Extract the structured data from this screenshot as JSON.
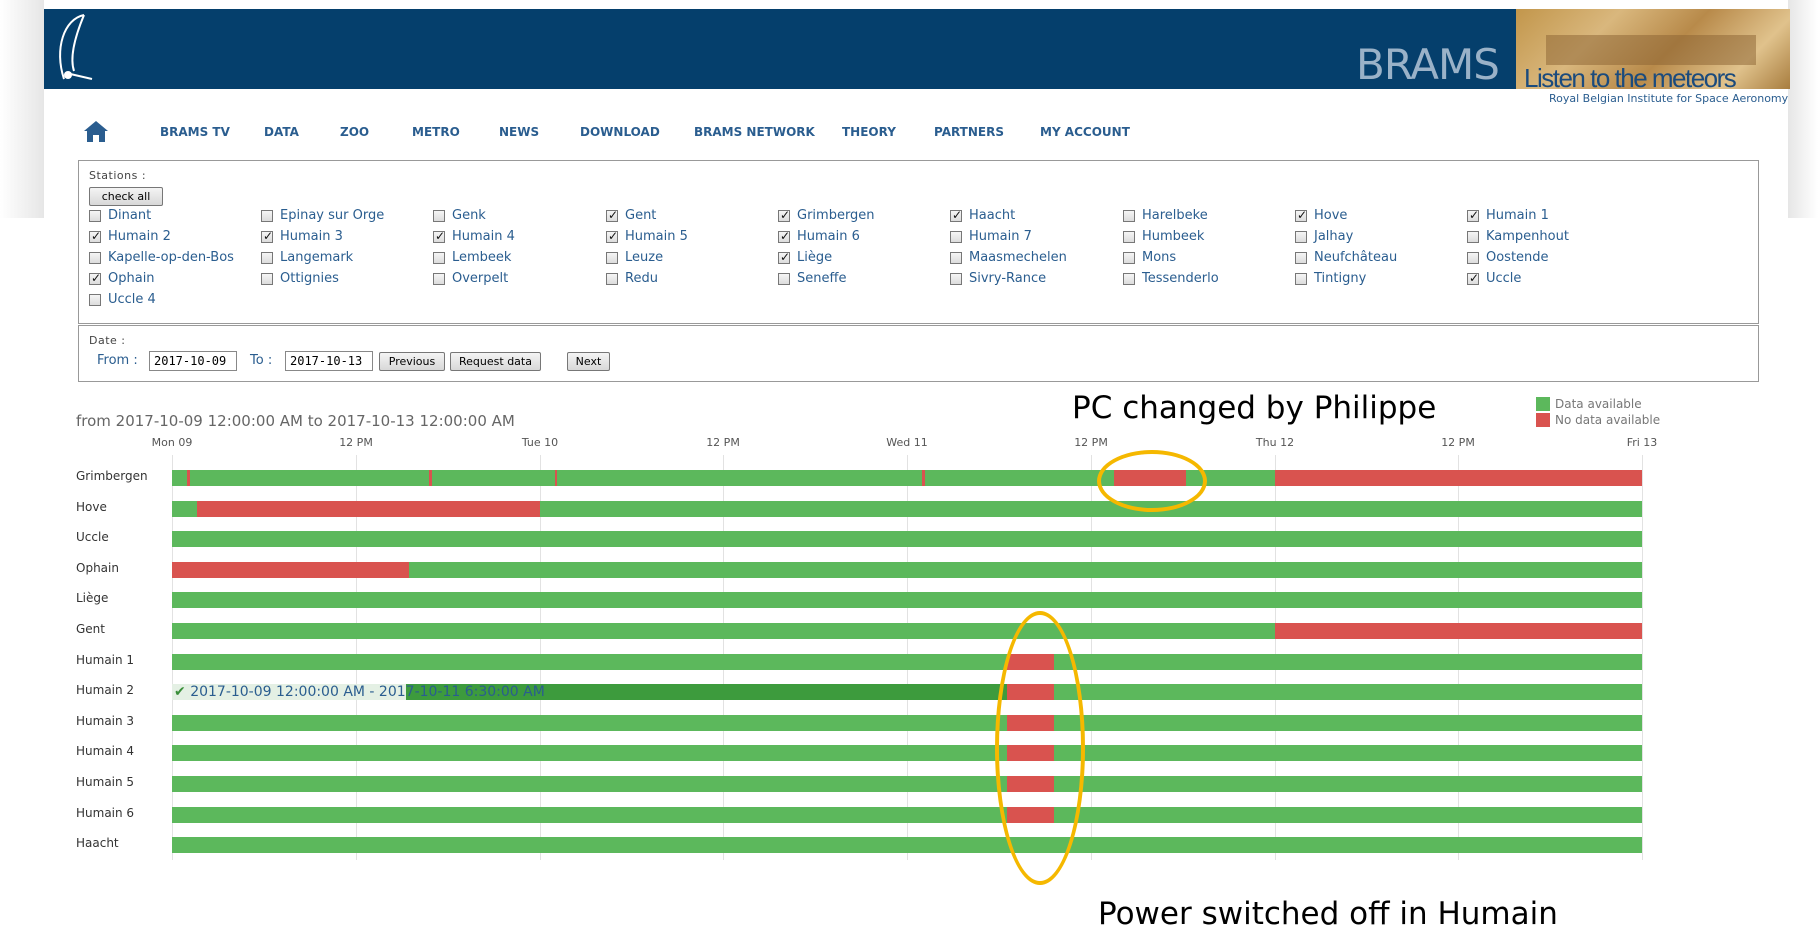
{
  "header": {
    "brand": "BRAMS",
    "tagline": "Listen to the meteors",
    "org": "Royal Belgian Institute for Space Aeronomy"
  },
  "nav": {
    "items": [
      "BRAMS TV",
      "DATA",
      "ZOO",
      "METRO",
      "NEWS",
      "DOWNLOAD",
      "BRAMS NETWORK",
      "THEORY",
      "PARTNERS",
      "MY ACCOUNT"
    ]
  },
  "stations_panel": {
    "title": "Stations :",
    "check_all": "check all",
    "stations": [
      {
        "name": "Dinant",
        "checked": false
      },
      {
        "name": "Epinay sur Orge",
        "checked": false
      },
      {
        "name": "Genk",
        "checked": false
      },
      {
        "name": "Gent",
        "checked": true
      },
      {
        "name": "Grimbergen",
        "checked": true
      },
      {
        "name": "Haacht",
        "checked": true
      },
      {
        "name": "Harelbeke",
        "checked": false
      },
      {
        "name": "Hove",
        "checked": true
      },
      {
        "name": "Humain 1",
        "checked": true
      },
      {
        "name": "Humain 2",
        "checked": true
      },
      {
        "name": "Humain 3",
        "checked": true
      },
      {
        "name": "Humain 4",
        "checked": true
      },
      {
        "name": "Humain 5",
        "checked": true
      },
      {
        "name": "Humain 6",
        "checked": true
      },
      {
        "name": "Humain 7",
        "checked": false
      },
      {
        "name": "Humbeek",
        "checked": false
      },
      {
        "name": "Jalhay",
        "checked": false
      },
      {
        "name": "Kampenhout",
        "checked": false
      },
      {
        "name": "Kapelle-op-den-Bos",
        "checked": false
      },
      {
        "name": "Langemark",
        "checked": false
      },
      {
        "name": "Lembeek",
        "checked": false
      },
      {
        "name": "Leuze",
        "checked": false
      },
      {
        "name": "Liège",
        "checked": true
      },
      {
        "name": "Maasmechelen",
        "checked": false
      },
      {
        "name": "Mons",
        "checked": false
      },
      {
        "name": "Neufchâteau",
        "checked": false
      },
      {
        "name": "Oostende",
        "checked": false
      },
      {
        "name": "Ophain",
        "checked": true
      },
      {
        "name": "Ottignies",
        "checked": false
      },
      {
        "name": "Overpelt",
        "checked": false
      },
      {
        "name": "Redu",
        "checked": false
      },
      {
        "name": "Seneffe",
        "checked": false
      },
      {
        "name": "Sivry-Rance",
        "checked": false
      },
      {
        "name": "Tessenderlo",
        "checked": false
      },
      {
        "name": "Tintigny",
        "checked": false
      },
      {
        "name": "Uccle",
        "checked": true
      },
      {
        "name": "Uccle 4",
        "checked": false
      }
    ]
  },
  "date_panel": {
    "title": "Date :",
    "from_label": "From :",
    "from_value": "2017-10-09",
    "to_label": "To :",
    "to_value": "2017-10-13",
    "previous": "Previous",
    "request": "Request data",
    "next": "Next"
  },
  "timeline": {
    "range_text": "from 2017-10-09 12:00:00 AM to 2017-10-13 12:00:00 AM",
    "legend": [
      {
        "label": "Data available",
        "color": "#5cb85c"
      },
      {
        "label": "No data available",
        "color": "#d9534f"
      }
    ],
    "tooltip": "2017-10-09 12:00:00 AM - 2017-10-11 6:30:00 AM"
  },
  "chart_data": {
    "type": "timeline",
    "x_unit": "hours since 2017-10-09 00:00",
    "xlim": [
      0,
      96
    ],
    "ticks": [
      {
        "label": "Mon 09",
        "hour": 0
      },
      {
        "label": "12 PM",
        "hour": 12
      },
      {
        "label": "Tue 10",
        "hour": 24
      },
      {
        "label": "12 PM",
        "hour": 36
      },
      {
        "label": "Wed 11",
        "hour": 48
      },
      {
        "label": "12 PM",
        "hour": 60
      },
      {
        "label": "Thu 12",
        "hour": 72
      },
      {
        "label": "12 PM",
        "hour": 84
      },
      {
        "label": "Fri 13",
        "hour": 96
      }
    ],
    "colors": {
      "available": "#5cb85c",
      "missing": "#d9534f",
      "highlight": "#3d9b3d"
    },
    "rows": [
      {
        "name": "Grimbergen",
        "gaps": [
          [
            1.0,
            1.15
          ],
          [
            16.8,
            16.95
          ],
          [
            25.0,
            25.15
          ],
          [
            49.0,
            49.15
          ],
          [
            61.5,
            66.2
          ],
          [
            72.0,
            96.0
          ]
        ]
      },
      {
        "name": "Hove",
        "gaps": [
          [
            1.6,
            24.0
          ]
        ]
      },
      {
        "name": "Uccle",
        "gaps": []
      },
      {
        "name": "Ophain",
        "gaps": [
          [
            0.0,
            15.5
          ]
        ]
      },
      {
        "name": "Liège",
        "gaps": []
      },
      {
        "name": "Gent",
        "gaps": [
          [
            72.0,
            96.0
          ]
        ]
      },
      {
        "name": "Humain 1",
        "gaps": [
          [
            54.5,
            57.6
          ]
        ]
      },
      {
        "name": "Humain 2",
        "gaps": [
          [
            54.5,
            57.6
          ]
        ],
        "highlight": [
          0.0,
          54.5
        ]
      },
      {
        "name": "Humain 3",
        "gaps": [
          [
            54.5,
            57.6
          ]
        ]
      },
      {
        "name": "Humain 4",
        "gaps": [
          [
            54.5,
            57.6
          ]
        ]
      },
      {
        "name": "Humain 5",
        "gaps": [
          [
            54.5,
            57.6
          ]
        ]
      },
      {
        "name": "Humain 6",
        "gaps": [
          [
            54.5,
            57.6
          ]
        ]
      },
      {
        "name": "Haacht",
        "gaps": []
      }
    ]
  },
  "annotations": {
    "top": "PC changed by Philippe",
    "bottom": "Power switched off in Humain"
  }
}
